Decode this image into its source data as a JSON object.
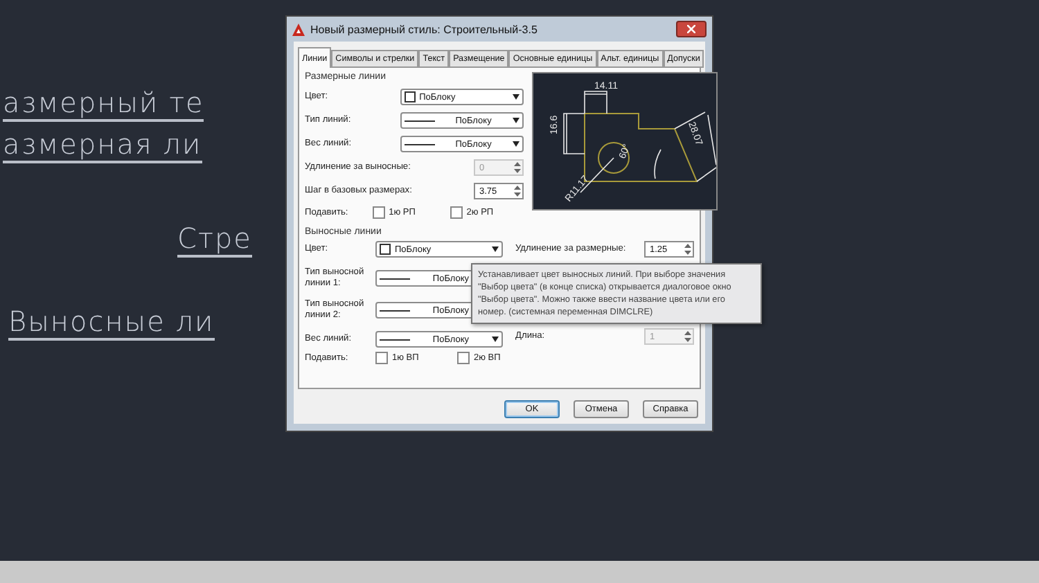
{
  "canvas_labels": [
    "азмерный те",
    "азмерная ли",
    "Стре",
    "Выносные ли"
  ],
  "dialog": {
    "title": "Новый размерный стиль: Строительный-3.5",
    "tabs": [
      {
        "label": "Линии",
        "selected": true
      },
      {
        "label": "Символы и стрелки",
        "selected": false
      },
      {
        "label": "Текст",
        "selected": false
      },
      {
        "label": "Размещение",
        "selected": false
      },
      {
        "label": "Основные единицы",
        "selected": false
      },
      {
        "label": "Альт. единицы",
        "selected": false
      },
      {
        "label": "Допуски",
        "selected": false
      }
    ],
    "dim_lines": {
      "title": "Размерные линии",
      "fields": [
        {
          "kind": "color",
          "label": "Цвет:",
          "value": "ПоБлоку"
        },
        {
          "kind": "linetype",
          "label": "Тип линий:",
          "value": "ПоБлоку"
        },
        {
          "kind": "linetype",
          "label": "Вес линий:",
          "value": "ПоБлоку"
        }
      ],
      "spins": [
        {
          "label": "Удлинение за выносные:",
          "value": "0",
          "disabled": true
        },
        {
          "label": "Шаг в базовых размерах:",
          "value": "3.75",
          "disabled": false
        }
      ],
      "suppress": {
        "label": "Подавить:",
        "options": [
          {
            "label": "1ю РП",
            "checked": false
          },
          {
            "label": "2ю РП",
            "checked": false
          }
        ]
      }
    },
    "preview": {
      "labels": [
        "14.11",
        "16.6",
        "28.07",
        "60°",
        "R11.17"
      ]
    },
    "ext_lines": {
      "title": "Выносные линии",
      "fields": [
        {
          "kind": "color",
          "label": "Цвет:",
          "value": "ПоБлоку"
        },
        {
          "kind": "linetype",
          "label": "Тип выносной линии 1:",
          "value": "ПоБлоку"
        },
        {
          "kind": "linetype",
          "label": "Тип выносной линии 2:",
          "value": "ПоБлоку"
        },
        {
          "kind": "linetype",
          "label": "Вес линий:",
          "value": "ПоБлоку"
        }
      ],
      "suppress": {
        "label": "Подавить:",
        "options": [
          {
            "label": "1ю ВП",
            "checked": false
          },
          {
            "label": "2ю ВП",
            "checked": false
          }
        ]
      },
      "extend": {
        "label": "Удлинение за размерные:",
        "value": "1.25",
        "disabled": false
      },
      "length": {
        "label": "Длина:",
        "value": "1",
        "disabled": true
      }
    },
    "buttons": [
      {
        "label": "OK",
        "default": true
      },
      {
        "label": "Отмена",
        "default": false
      },
      {
        "label": "Справка",
        "default": false
      }
    ]
  },
  "tooltip": "Устанавливает цвет выносных линий. При выборе значения \"Выбор цвета\" (в конце списка) открывается диалоговое окно \"Выбор цвета\". Можно также ввести название цвета или его номер. (системная переменная DIMCLRE)"
}
